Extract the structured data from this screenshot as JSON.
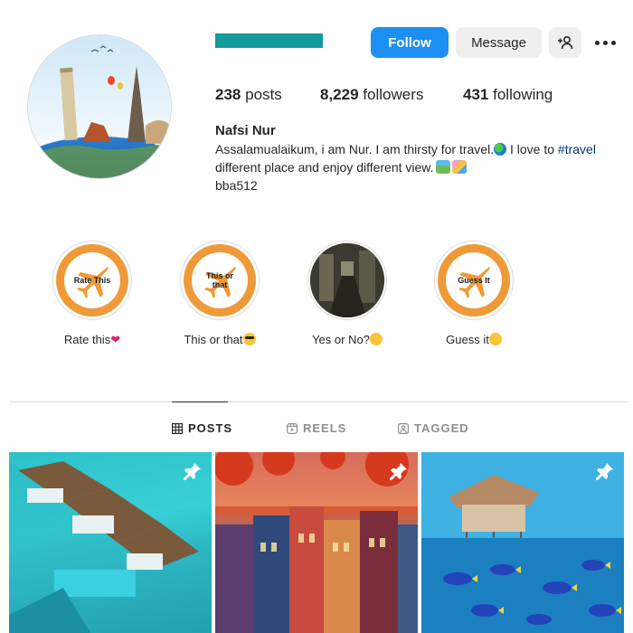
{
  "header": {
    "buttons": {
      "follow": "Follow",
      "message": "Message"
    },
    "icons": [
      "add-user-icon",
      "more-options-icon"
    ]
  },
  "stats": {
    "posts_count": "238",
    "posts_label": "posts",
    "followers_count": "8,229",
    "followers_label": "followers",
    "following_count": "431",
    "following_label": "following"
  },
  "profile": {
    "full_name": "Nafsi Nur",
    "bio_line1_before": "Assalamualaikum, i am Nur. I am thirsty for travel.",
    "bio_line1_after": " I love to ",
    "bio_hashtag": "#travel",
    "bio_line2": "different place and enjoy different view.",
    "link": "bba512"
  },
  "highlights": [
    {
      "cover_text": "Rate This",
      "label": "Rate this",
      "emoji": "red-heart"
    },
    {
      "cover_text": "This or that",
      "label": "This or that",
      "emoji": "sunglasses-face"
    },
    {
      "cover_text": "",
      "label": "Yes or No?",
      "emoji": "thinking-face"
    },
    {
      "cover_text": "Guess It",
      "label": "Guess it",
      "emoji": "monocle-face"
    }
  ],
  "tabs": [
    {
      "label": "POSTS",
      "icon": "grid-icon",
      "active": true
    },
    {
      "label": "REELS",
      "icon": "reels-icon",
      "active": false
    },
    {
      "label": "TAGGED",
      "icon": "tagged-icon",
      "active": false
    }
  ],
  "posts": [
    {
      "pinned": true,
      "subject": "overwater villas"
    },
    {
      "pinned": true,
      "subject": "colorful houses with red leaves"
    },
    {
      "pinned": true,
      "subject": "hut above sea with fish"
    }
  ],
  "colors": {
    "follow_button": "#1c8ff4",
    "secondary_button": "#efefef",
    "highlight_orange": "#ef9a38",
    "hashtag": "#00376b",
    "username_redaction": "#149b9b"
  }
}
